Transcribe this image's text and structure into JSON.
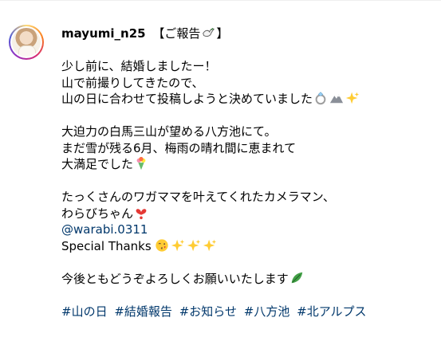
{
  "post": {
    "username": "mayumi_n25",
    "caption_title": "【ご報告",
    "caption_title_end": "】",
    "lines": [
      "少し前に、結婚しましたー！",
      "山で前撮りしてきたので、",
      "山の日に合わせて投稿しようと決めていました",
      "大迫力の白馬三山が望める八方池にて。",
      "まだ雪が残る6月、梅雨の晴れ間に恵まれて",
      "大満足でした",
      "たっくさんのワガママを叶えてくれたカメラマン、",
      "わらびちゃん",
      "@warabi.0311",
      "Special Thanks",
      "今後ともどうぞよろしくお願いいたします"
    ],
    "hashtags": [
      "#山の日",
      "#結婚報告",
      "#お知らせ",
      "#八方池",
      "#北アルプス"
    ],
    "icons": {
      "title": "dove-icon",
      "ring": "ring-icon",
      "mountain": "mountain-icon",
      "sparkles": "sparkles-icon",
      "bouquet": "bouquet-icon",
      "heart": "heart-icon",
      "kiss": "kissing-face-icon",
      "leaf": "leaf-icon"
    },
    "colors": {
      "text": "#000000",
      "link": "#00376b",
      "ring_gradient_start": "#feda75",
      "ring_gradient_end": "#962fbf"
    }
  }
}
